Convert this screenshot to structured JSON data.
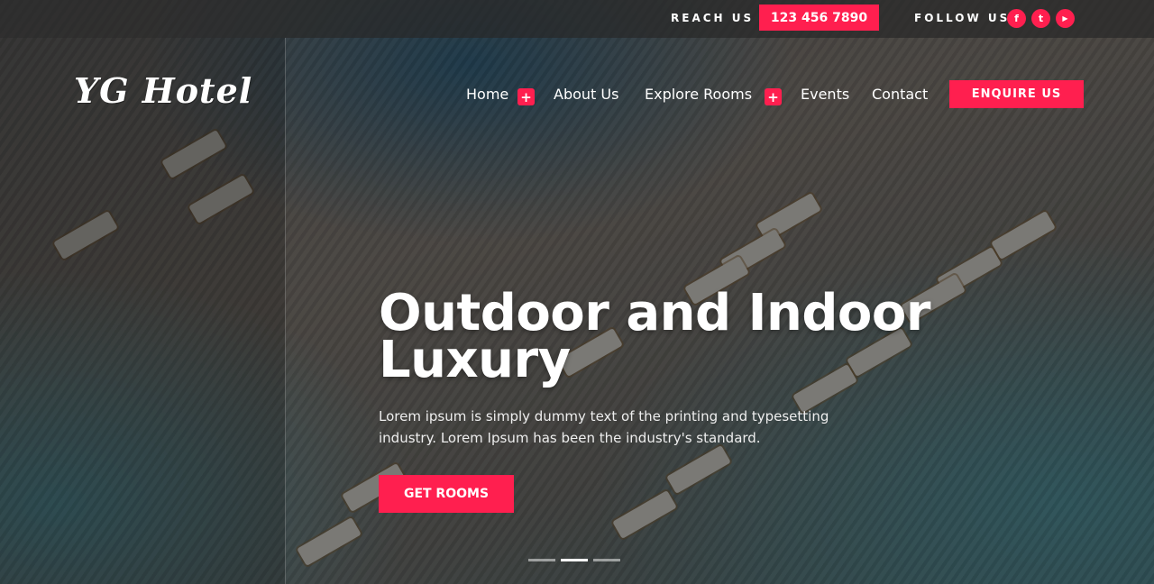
{
  "topbar": {
    "reach_label": "REACH US",
    "phone": "123 456 7890",
    "follow_label": "FOLLOW US",
    "social": [
      {
        "icon": "facebook-icon",
        "glyph": "f"
      },
      {
        "icon": "twitter-icon",
        "glyph": "t"
      },
      {
        "icon": "youtube-icon",
        "glyph": "▶"
      }
    ]
  },
  "logo": "YG Hotel",
  "nav": {
    "items": [
      {
        "label": "Home",
        "has_submenu": true
      },
      {
        "label": "About Us",
        "has_submenu": false
      },
      {
        "label": "Explore Rooms",
        "has_submenu": true
      },
      {
        "label": "Events",
        "has_submenu": false
      },
      {
        "label": "Contact",
        "has_submenu": false
      }
    ],
    "plus_glyph": "+",
    "enquire": "ENQUIRE US"
  },
  "hero": {
    "headline": "Outdoor and Indoor Luxury",
    "subtext": "Lorem ipsum is simply dummy text of the printing and typesetting industry. Lorem Ipsum has been the industry's standard.",
    "cta": "GET ROOMS",
    "slides": 3,
    "active_slide": 2
  },
  "colors": {
    "accent": "#ff1f4f",
    "text": "#ffffff"
  }
}
